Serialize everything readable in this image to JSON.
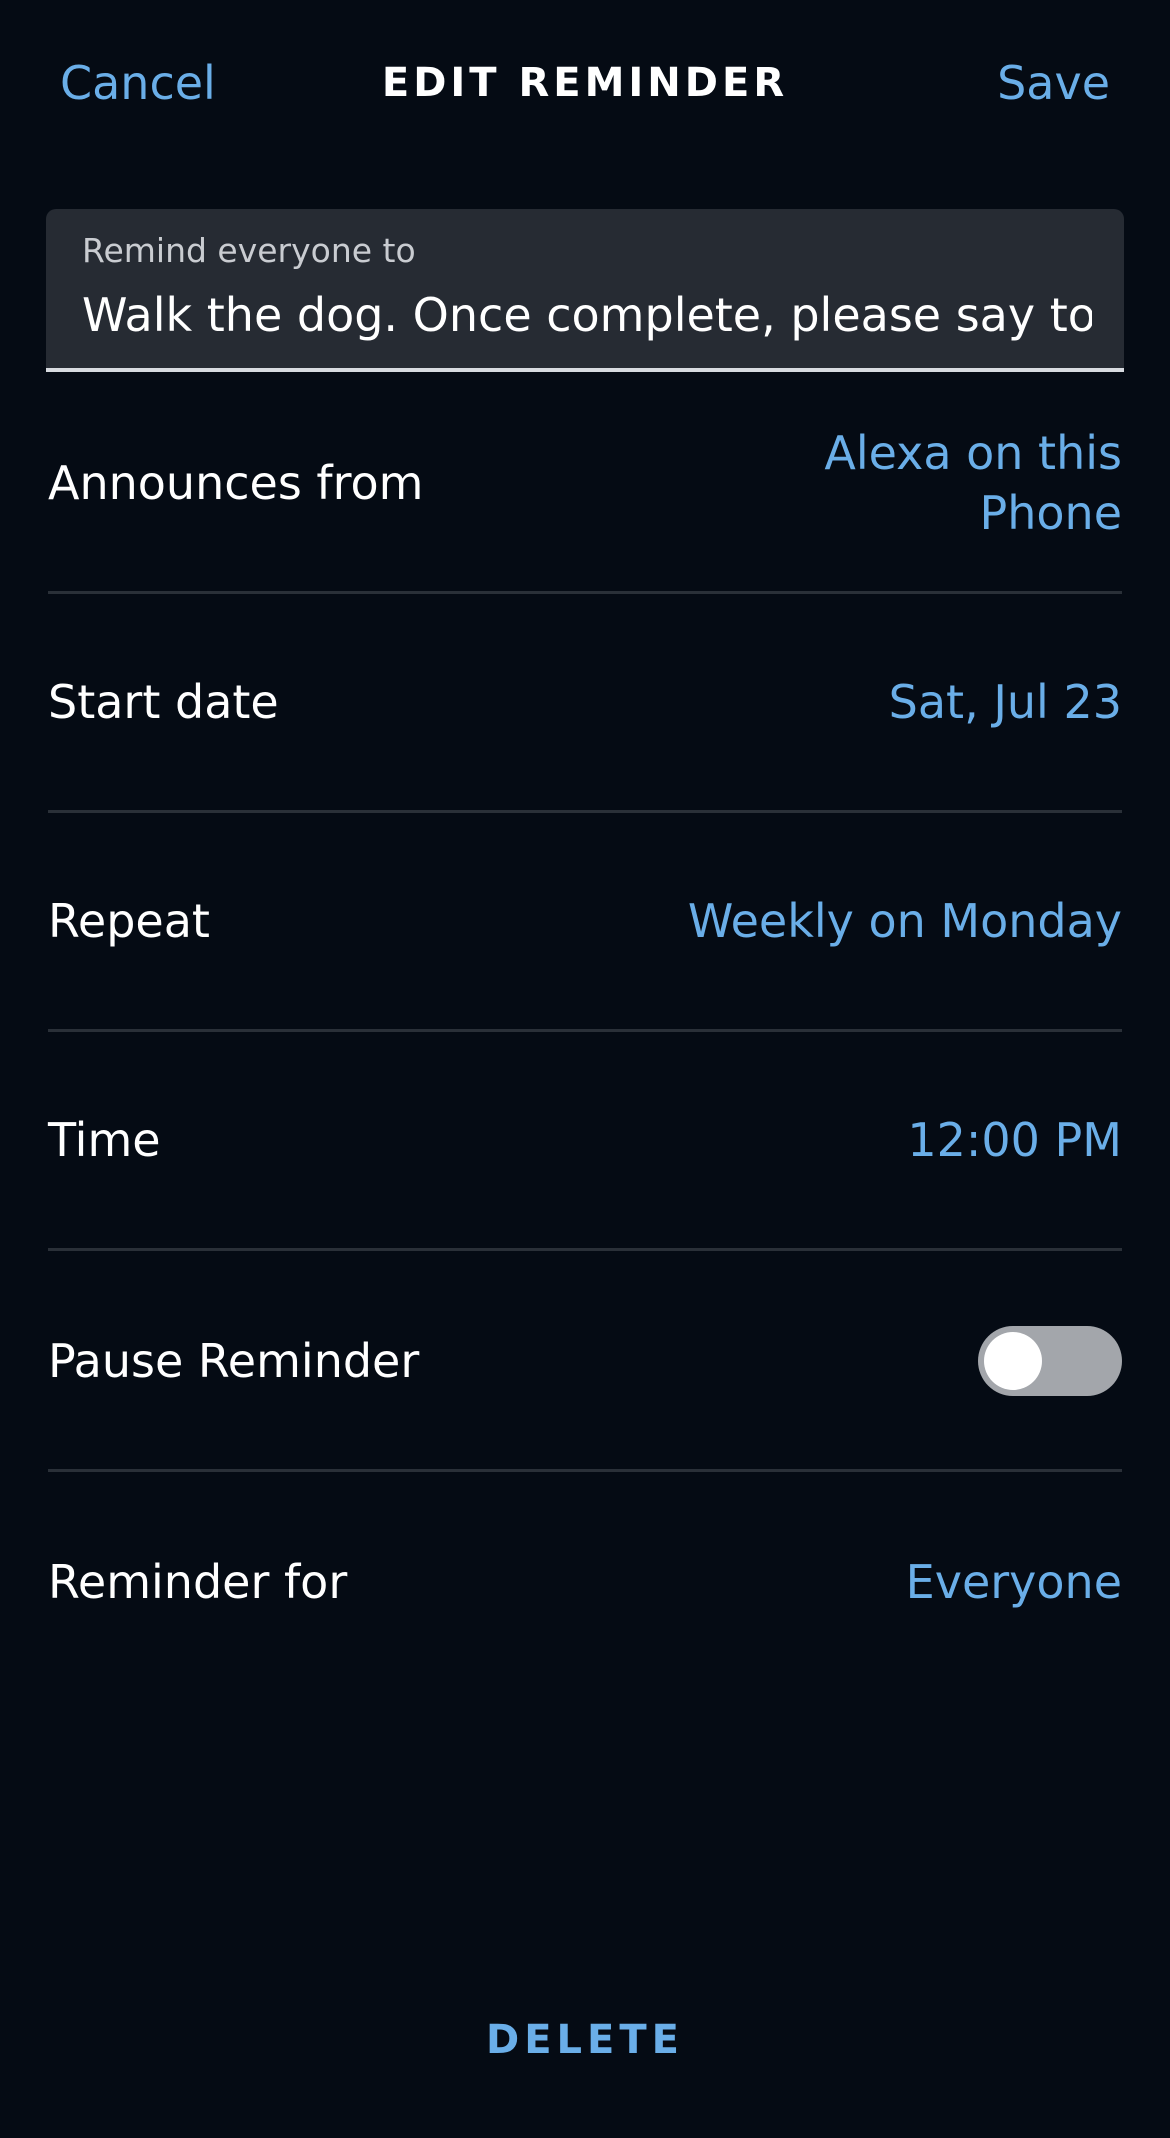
{
  "header": {
    "cancel_label": "Cancel",
    "title": "EDIT REMINDER",
    "save_label": "Save"
  },
  "reminder_field": {
    "label": "Remind everyone to",
    "value": "Walk the dog. Once complete, please say to"
  },
  "settings": {
    "announces_from": {
      "label": "Announces from",
      "value": "Alexa on this Phone"
    },
    "start_date": {
      "label": "Start date",
      "value": "Sat, Jul 23"
    },
    "repeat": {
      "label": "Repeat",
      "value": "Weekly on Monday"
    },
    "time": {
      "label": "Time",
      "value": "12:00 PM"
    },
    "pause_reminder": {
      "label": "Pause Reminder",
      "enabled": false
    },
    "reminder_for": {
      "label": "Reminder for",
      "value": "Everyone"
    }
  },
  "footer": {
    "delete_label": "DELETE"
  },
  "colors": {
    "background": "#050b14",
    "accent": "#6aaee8",
    "field_background": "#262b33",
    "toggle_off": "#a3a6ab"
  }
}
